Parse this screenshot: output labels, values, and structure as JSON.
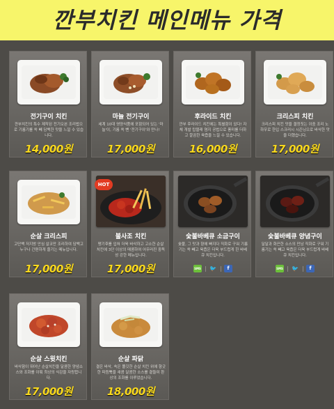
{
  "page": {
    "title": "깐부치킨 메인메뉴 가격"
  },
  "hot_badge": "HOT",
  "share": {
    "sms": "SMS",
    "twitter": "🐦",
    "facebook": "f"
  },
  "menu": [
    {
      "name": "전기구이 치킨",
      "desc": "깐부치킨의 특수 제작된 전기오븐 조리법으로 기름기를 쏙 빼 담백한 맛을 느낄 수 있습니다.",
      "price": "14,000원"
    },
    {
      "name": "마늘 전기구이",
      "desc": "세계 10대 영양식품에 포함되어 있는 '마늘'이, 기름 쏙 뺀 '전기구이'와 만나!",
      "price": "17,000원"
    },
    {
      "name": "후라이드 치킨",
      "desc": "깐부 후라이드 치킨에는 특별함이 있다! 자체 개발 탑블래 염지 공법으로 풍미를 더하고 깔끔한 육즙을 느낄 수 있습니다.",
      "price": "16,000원"
    },
    {
      "name": "크리스피 치킨",
      "desc": "크리스피 치킨 맛을 결정짓는 이중 조리 노하우로 한입 스크러시 시즌닝으로 바삭한 맛을 더했습니다.",
      "price": "17,000원"
    },
    {
      "name": "순살 크리스피",
      "desc": "고단백 저지방 안심 살코만 조리하여 담백고 누구나 간편하게 즐기는 메뉴입니다.",
      "price": "17,000원"
    },
    {
      "name": "불사조 치킨",
      "desc": "땡기후를 입혀 더욱 바삭하고 고소한 순살 치킨에 3단 이상의 매콤하여 어우러진 중독성 강한 메뉴입니다.",
      "price": "17,000원"
    },
    {
      "name": "숯불바베큐 소금구이",
      "desc": "숯불, 그 맛과 향에 빠지다 직화로 구워 기름기는 쏙 빼고 육즙은 더욱 부드럽게 한 바베큐 치킨입니다.",
      "price": ""
    },
    {
      "name": "숯불바베큐 양념구이",
      "desc": "달달과 화끈한 소스의 만남 직화로 구워 기름기는 쏙 빼고 육즙은 더욱 부드럽게 바베큐 치킨입니다.",
      "price": ""
    },
    {
      "name": "순살 스윗치킨",
      "desc": "바삭함이 뛰어난 순살치킨을 달콤한 양념소스와 조화를 이뤄 최상의 식감을 자랑합니다.",
      "price": "17,000원"
    },
    {
      "name": "순살 파닭",
      "desc": "결은 바삭, 속은 쫄깃한 순살 치킨 위에 향긋한 파듬뿍을 새콤 달콤한 소스를 곁들여 환상의 조화를 이루었습니다.",
      "price": "18,000원"
    }
  ]
}
